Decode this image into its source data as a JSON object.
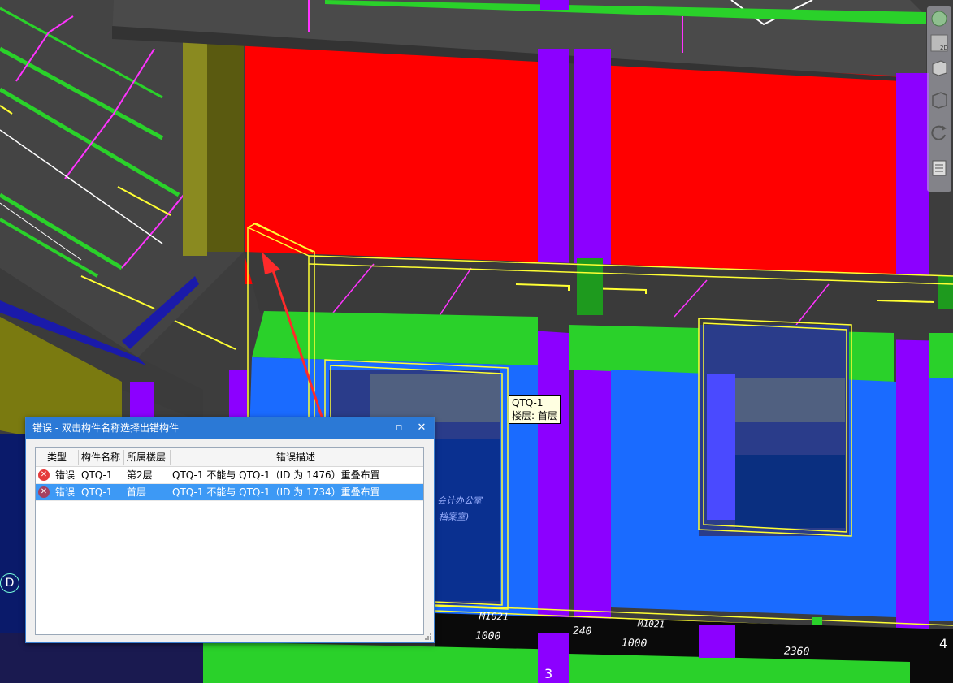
{
  "tooltip": {
    "name": "QTQ-1",
    "floor": "楼层: 首层"
  },
  "dialog": {
    "title": "错误 - 双击构件名称选择出错构件",
    "maximize_icon": "maximize-icon",
    "close_icon": "close-icon",
    "columns": [
      "类型",
      "构件名称",
      "所属楼层",
      "错误描述"
    ],
    "rows": [
      {
        "type": "错误",
        "name": "QTQ-1",
        "floor": "第2层",
        "desc": "QTQ-1 不能与 QTQ-1（ID 为 1476）重叠布置",
        "selected": false
      },
      {
        "type": "错误",
        "name": "QTQ-1",
        "floor": "首层",
        "desc": "QTQ-1 不能与 QTQ-1（ID 为 1734）重叠布置",
        "selected": true
      }
    ]
  },
  "scene": {
    "dims": [
      "M1021",
      "1000",
      "240",
      "M1021",
      "1000",
      "2360",
      "240"
    ],
    "room_label_1": "会计办公室",
    "room_label_2": "档案室)",
    "axis_3": "3",
    "axis_4": "4",
    "axis_d": "D",
    "toolbar_2d": "2D"
  },
  "colors": {
    "wall_red": "#ff0000",
    "beam_green": "#2ad12a",
    "column_purple": "#8c00ff",
    "wall_blue": "#1a6bff",
    "highlight_yellow": "#ffff33",
    "slab_gray": "#404040",
    "dialog_title": "#2b79d6",
    "row_selected": "#3d99f5"
  }
}
